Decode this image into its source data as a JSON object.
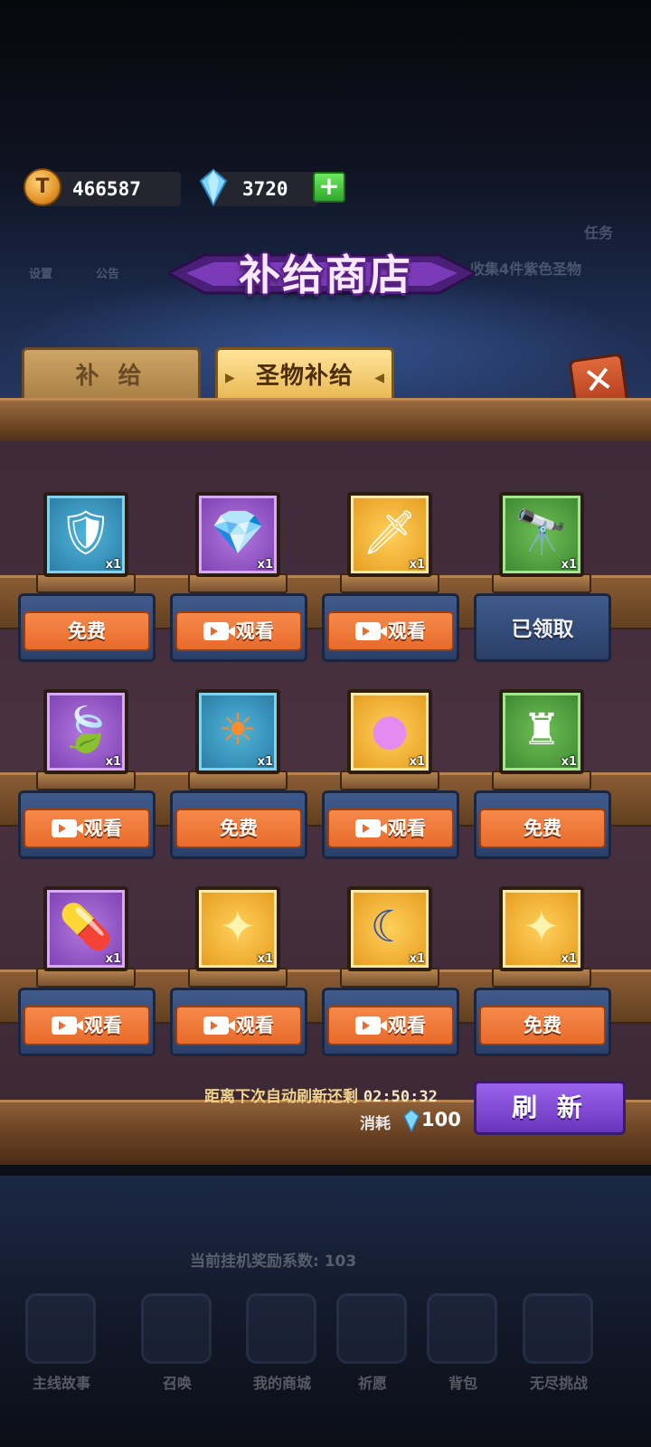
{
  "currency": {
    "gold": "466587",
    "gems": "3720",
    "coin_symbol": "T",
    "add_symbol": "+"
  },
  "shop": {
    "title": "补给商店",
    "tabs": [
      {
        "label": "补 给",
        "active": false
      },
      {
        "label": "圣物补给",
        "active": true
      }
    ],
    "close_symbol": "✕"
  },
  "items": [
    {
      "rarity": "blue",
      "icon": "crimson-armor-icon",
      "qty": "x1",
      "action": "免费",
      "video": false
    },
    {
      "rarity": "purple",
      "icon": "crystal-cluster-icon",
      "qty": "x1",
      "action": "观看",
      "video": true
    },
    {
      "rarity": "gold",
      "icon": "red-dagger-icon",
      "qty": "x1",
      "action": "观看",
      "video": true
    },
    {
      "rarity": "green",
      "icon": "telescope-icon",
      "qty": "x1",
      "action": "已领取",
      "video": false,
      "claimed": true
    },
    {
      "rarity": "purple",
      "icon": "leaf-shield-icon",
      "qty": "x1",
      "action": "观看",
      "video": true
    },
    {
      "rarity": "blue",
      "icon": "sun-orb-icon",
      "qty": "x1",
      "action": "免费",
      "video": false
    },
    {
      "rarity": "gold",
      "icon": "pink-slime-icon",
      "qty": "x1",
      "action": "观看",
      "video": true
    },
    {
      "rarity": "green",
      "icon": "ornate-trophy-icon",
      "qty": "x1",
      "action": "免费",
      "video": false
    },
    {
      "rarity": "purple",
      "icon": "capsule-icon",
      "qty": "x1",
      "action": "观看",
      "video": true
    },
    {
      "rarity": "gold",
      "icon": "gold-star-icon",
      "qty": "x1",
      "action": "观看",
      "video": true
    },
    {
      "rarity": "gold",
      "icon": "crescent-moon-icon",
      "qty": "x1",
      "action": "观看",
      "video": true
    },
    {
      "rarity": "gold",
      "icon": "gold-star-icon",
      "qty": "x1",
      "action": "免费",
      "video": false
    }
  ],
  "refresh": {
    "timer_label": "距离下次自动刷新还剩",
    "time": "02:50:32",
    "cost_label": "消耗",
    "cost": "100",
    "button": "刷 新"
  },
  "background": {
    "menu": [
      "设置",
      "公告"
    ],
    "task_tab": "任务",
    "task_text": "收集4件紫色圣物",
    "idle_hint": "当前挂机奖励系数: 103",
    "bottom_nav": [
      "主线故事",
      "召唤",
      "我的商城",
      "祈愿",
      "背包",
      "无尽挑战"
    ]
  },
  "colors": {
    "rarity_blue": "#2a7aa3",
    "rarity_purple": "#7b3fb0",
    "rarity_gold": "#e59a1d",
    "rarity_green": "#3b8630",
    "action_orange": "#e86b2b",
    "refresh_purple": "#6a35bd"
  }
}
